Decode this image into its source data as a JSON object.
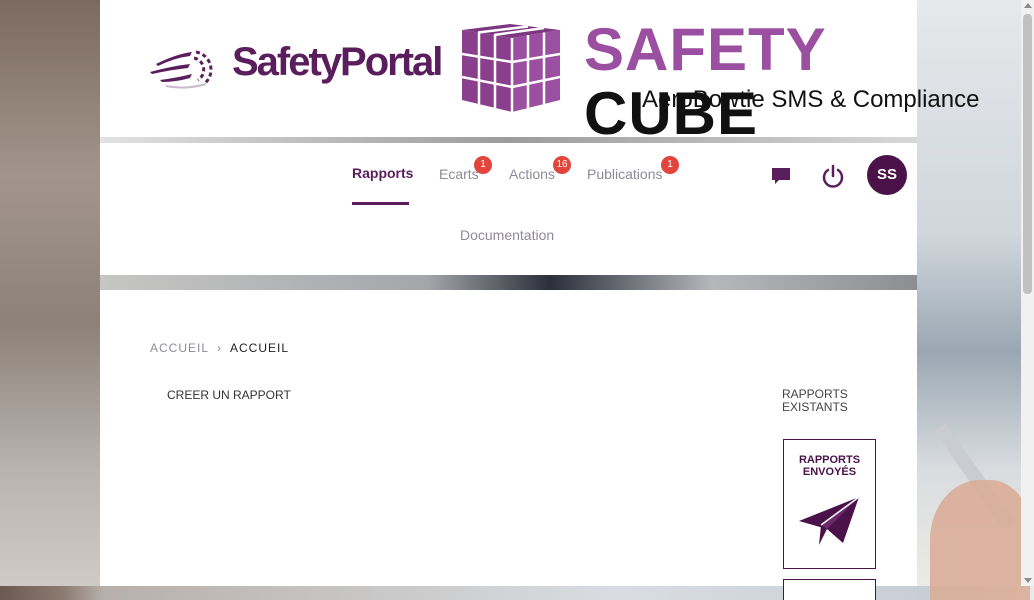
{
  "banner": {
    "safety_portal_text": "SafetyPortal",
    "title_part1": "SAFETY",
    "title_part2": "CUBE",
    "subtitle": "AeroBowtie SMS & Compliance"
  },
  "nav": {
    "items": [
      {
        "label": "Rapports",
        "active": true
      },
      {
        "label": "Ecarts",
        "badge": "1"
      },
      {
        "label": "Actions",
        "badge": "16"
      },
      {
        "label": "Publications",
        "badge": "1"
      },
      {
        "label": "Documentation"
      }
    ],
    "avatar_initials": "SS",
    "icons": [
      "chat-icon",
      "power-icon"
    ]
  },
  "breadcrumb": {
    "home": "ACCUEIL",
    "separator": ">",
    "current": "ACCUEIL"
  },
  "main": {
    "create_report": "CREER UN RAPPORT",
    "existing_reports": "RAPPORTS EXISTANTS",
    "sent_reports_card": "RAPPORTS ENVOYÉS"
  },
  "colors": {
    "brand_purple": "#5b1e5c",
    "accent_purple": "#9a4fa0",
    "badge_red": "#e2453c"
  }
}
